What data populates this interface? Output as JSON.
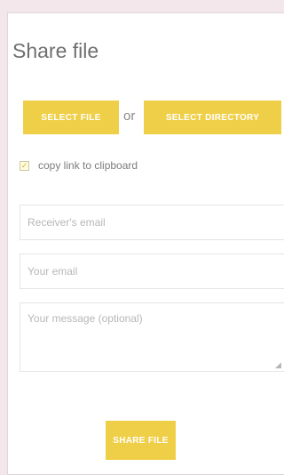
{
  "panel": {
    "title": "Share file"
  },
  "buttons": {
    "select_file": "SELECT FILE",
    "or_label": "or",
    "select_directory": "SELECT DIRECTORY",
    "share_file": "SHARE FILE"
  },
  "options": {
    "copy_link_label": "copy link to clipboard",
    "copy_link_checked": true
  },
  "form": {
    "receiver_email": {
      "placeholder": "Receiver's email",
      "value": ""
    },
    "your_email": {
      "placeholder": "Your email",
      "value": ""
    },
    "message": {
      "placeholder": "Your message (optional)",
      "value": ""
    }
  },
  "colors": {
    "accent": "#f0cf48",
    "background": "#f3e7ec",
    "panel": "#ffffff"
  },
  "icons": {
    "checkbox": "check-icon",
    "resize": "resize-handle-icon"
  }
}
